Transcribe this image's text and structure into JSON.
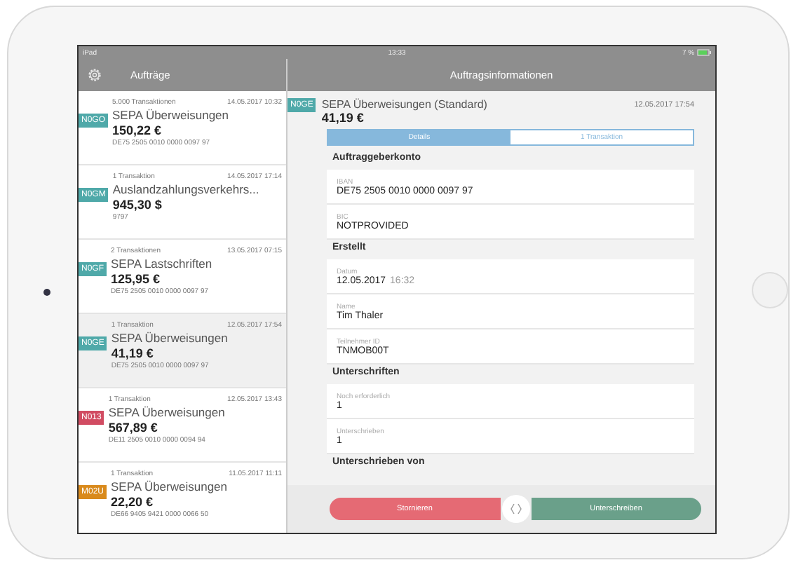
{
  "status_bar": {
    "device": "iPad",
    "time": "13:33",
    "battery": "7 %"
  },
  "sidebar": {
    "title": "Aufträge",
    "items": [
      {
        "count": "5.000 Transaktionen",
        "date": "14.05.2017 10:32",
        "badge": "N0GO",
        "color": "#4fa9a9",
        "title": "SEPA Überweisungen",
        "amount": "150,22 €",
        "account": "DE75 2505 0010 0000 0097 97",
        "selected": false
      },
      {
        "count": "1 Transaktion",
        "date": "14.05.2017 17:14",
        "badge": "N0GM",
        "color": "#4fa9a9",
        "title": "Auslandzahlungsverkehrs...",
        "amount": "945,30 $",
        "account": "9797",
        "selected": false
      },
      {
        "count": "2 Transaktionen",
        "date": "13.05.2017 07:15",
        "badge": "N0GF",
        "color": "#4fa9a9",
        "title": "SEPA Lastschriften",
        "amount": "125,95 €",
        "account": "DE75 2505 0010 0000 0097 97",
        "selected": false
      },
      {
        "count": "1 Transaktion",
        "date": "12.05.2017 17:54",
        "badge": "N0GE",
        "color": "#4fa9a9",
        "title": "SEPA Überweisungen",
        "amount": "41,19 €",
        "account": "DE75 2505 0010 0000 0097 97",
        "selected": true
      },
      {
        "count": "1 Transaktion",
        "date": "12.05.2017 13:43",
        "badge": "N013",
        "color": "#d14c62",
        "title": "SEPA Überweisungen",
        "amount": "567,89 €",
        "account": "DE11 2505 0010 0000 0094 94",
        "selected": false
      },
      {
        "count": "1 Transaktion",
        "date": "11.05.2017 11:11",
        "badge": "M02U",
        "color": "#d98a1c",
        "title": "SEPA Überweisungen",
        "amount": "22,20 €",
        "account": "DE66 9405 9421 0000 0066 50",
        "selected": false
      }
    ]
  },
  "detail": {
    "title": "Auftragsinformationen",
    "badge": "N0GE",
    "color": "#4fa9a9",
    "name": "SEPA Überweisungen (Standard)",
    "date": "12.05.2017 17:54",
    "amount": "41,19 €",
    "segments": [
      {
        "label": "Details",
        "selected": true
      },
      {
        "label": "1 Transaktion",
        "selected": false
      }
    ],
    "sections": [
      {
        "heading": "Auftraggeberkonto",
        "fields": [
          {
            "label": "IBAN",
            "value": "DE75 2505 0010 0000 0097 97"
          },
          {
            "label": "BIC",
            "value": "NOTPROVIDED"
          }
        ]
      },
      {
        "heading": "Erstellt",
        "fields": [
          {
            "label": "Datum",
            "value": "12.05.2017",
            "time": "16:32"
          },
          {
            "label": "Name",
            "value": "Tim Thaler"
          },
          {
            "label": "Teilnehmer ID",
            "value": "TNMOB00T"
          }
        ]
      },
      {
        "heading": "Unterschriften",
        "fields": [
          {
            "label": "Noch erforderlich",
            "value": "1"
          },
          {
            "label": "Unterschrieben",
            "value": "1"
          }
        ]
      },
      {
        "heading": "Unterschrieben von"
      }
    ]
  },
  "actions": [
    {
      "label": "Stornieren",
      "kind": "cancel"
    },
    {
      "label": "Unterschreiben",
      "kind": "sign"
    }
  ]
}
